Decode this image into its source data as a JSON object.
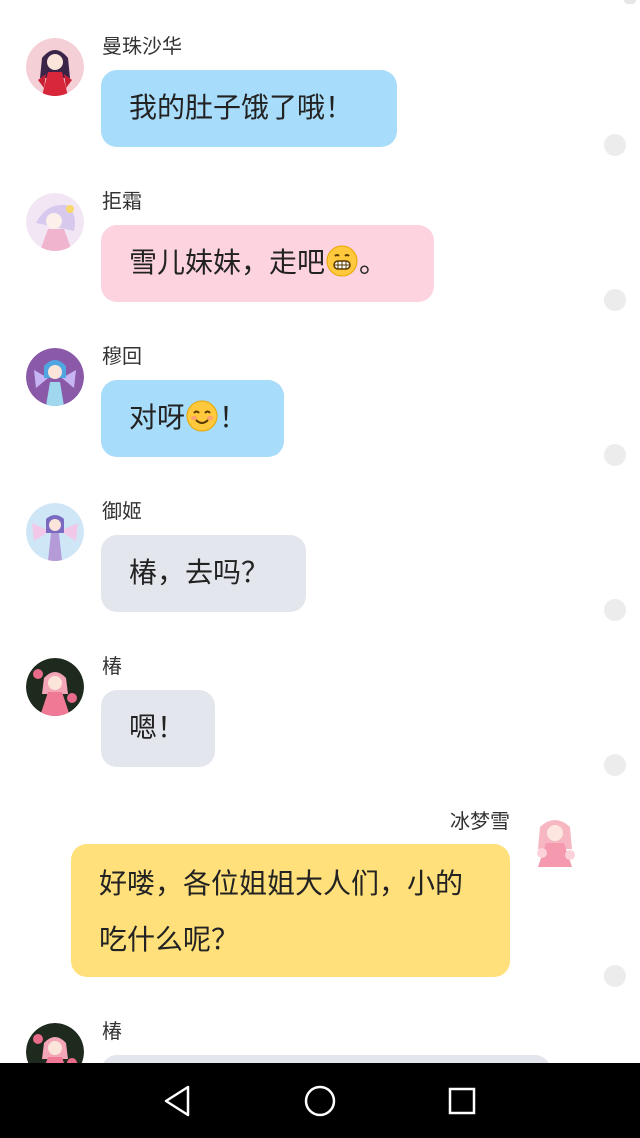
{
  "messages": [
    {
      "sender": "曼珠沙华",
      "text": "我的肚子饿了哦！",
      "side": "left",
      "bubble_color": "#a8dcfb"
    },
    {
      "sender": "拒霜",
      "text_before_emoji": "雪儿妹妹，走吧",
      "emoji": "grinning-face-emoji",
      "text_after_emoji": "。",
      "side": "left",
      "bubble_color": "#fcd3df"
    },
    {
      "sender": "穆回",
      "text_before_emoji": "对呀",
      "emoji": "smiling-face-emoji",
      "text_after_emoji": "！",
      "side": "left",
      "bubble_color": "#a8dcfb"
    },
    {
      "sender": "御姬",
      "text": "椿，去吗？",
      "side": "left",
      "bubble_color": "#e3e7ed"
    },
    {
      "sender": "椿",
      "text": "嗯！",
      "side": "left",
      "bubble_color": "#e3e7ed"
    },
    {
      "sender": "冰梦雪",
      "text": "好喽，各位姐姐大人们，小的吃什么呢？",
      "side": "right",
      "bubble_color": "#ffe07a"
    },
    {
      "sender": "椿",
      "text": "",
      "side": "left",
      "bubble_color": "#e3e7ed"
    }
  ],
  "nav": {
    "back": "back-triangle-icon",
    "home": "home-circle-icon",
    "recents": "recents-square-icon"
  }
}
